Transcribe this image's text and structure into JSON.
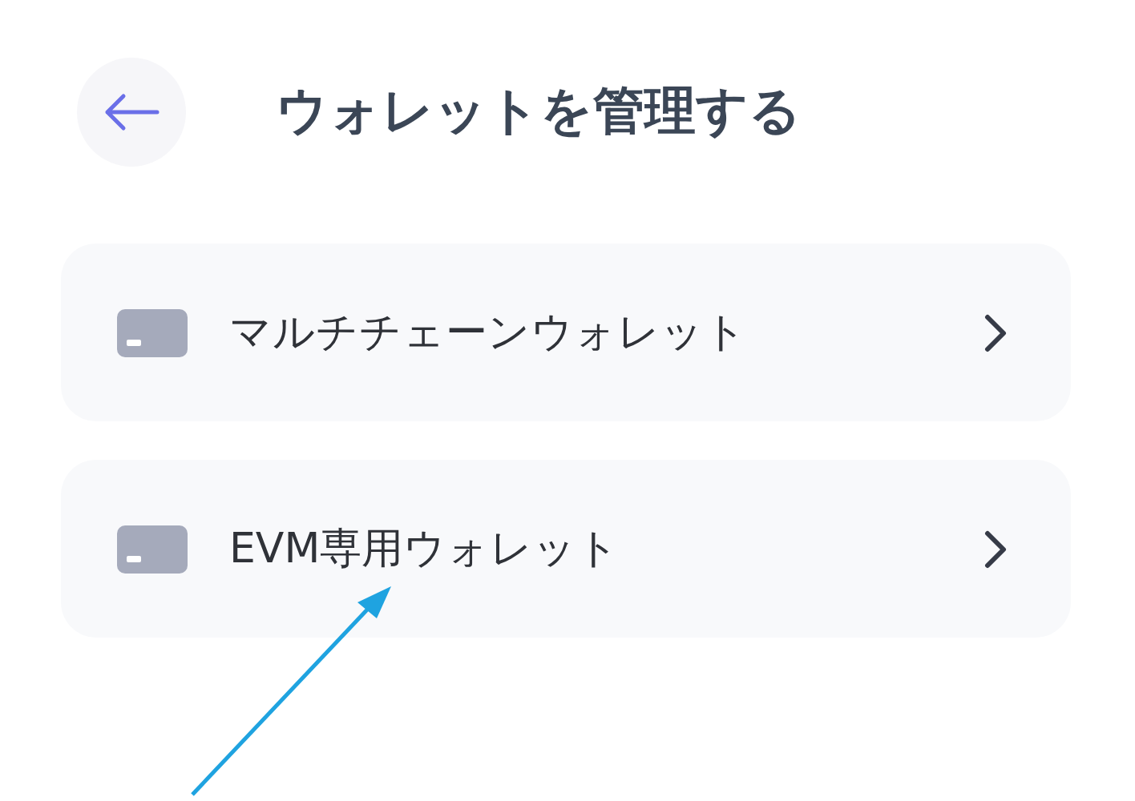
{
  "header": {
    "title": "ウォレットを管理する"
  },
  "items": [
    {
      "label": "マルチチェーンウォレット"
    },
    {
      "label": "EVM専用ウォレット"
    }
  ]
}
